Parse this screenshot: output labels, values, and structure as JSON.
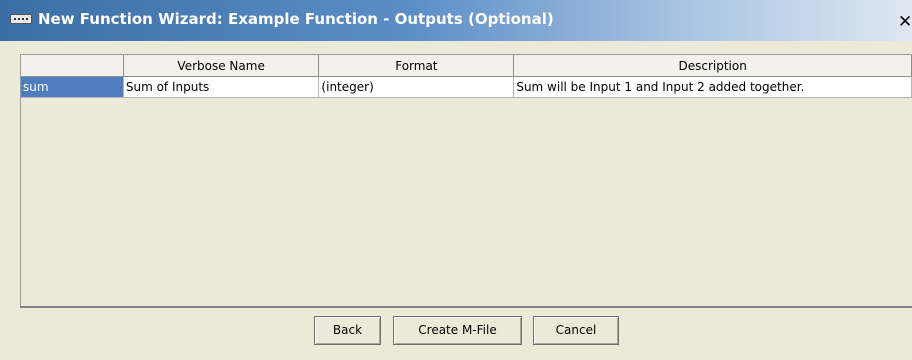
{
  "window": {
    "title": "New Function Wizard: Example Function - Outputs (Optional)",
    "close_glyph": "✕",
    "title_gradient_start": "#3a6ea5",
    "title_gradient_end": "#dfe7f1",
    "icon": "matlab-window-icon"
  },
  "table": {
    "columns": [
      "",
      "Verbose Name",
      "Format",
      "Description"
    ],
    "rows": [
      {
        "name": "sum",
        "verbose_name": "Sum of Inputs",
        "format": "(integer)",
        "description": "Sum will be Input 1 and Input 2 added together."
      }
    ],
    "selected_row_color": "#4f7dbd"
  },
  "buttons": {
    "back": "Back",
    "create": "Create M-File",
    "cancel": "Cancel"
  }
}
